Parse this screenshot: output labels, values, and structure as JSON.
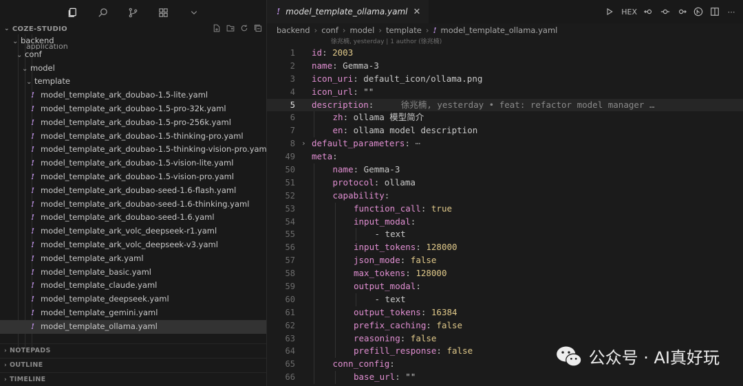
{
  "activity_bar": {
    "icons": [
      "files-icon",
      "search-icon",
      "source-control-icon",
      "extensions-icon",
      "chevron-down-icon"
    ]
  },
  "explorer": {
    "title": "COZE-STUDIO",
    "folders": {
      "backend": "backend",
      "peek": "application",
      "conf": "conf",
      "model": "model",
      "template": "template"
    },
    "files": [
      "model_template_ark_doubao-1.5-lite.yaml",
      "model_template_ark_doubao-1.5-pro-32k.yaml",
      "model_template_ark_doubao-1.5-pro-256k.yaml",
      "model_template_ark_doubao-1.5-thinking-pro.yaml",
      "model_template_ark_doubao-1.5-thinking-vision-pro.yaml",
      "model_template_ark_doubao-1.5-vision-lite.yaml",
      "model_template_ark_doubao-1.5-vision-pro.yaml",
      "model_template_ark_doubao-seed-1.6-flash.yaml",
      "model_template_ark_doubao-seed-1.6-thinking.yaml",
      "model_template_ark_doubao-seed-1.6.yaml",
      "model_template_ark_volc_deepseek-r1.yaml",
      "model_template_ark_volc_deepseek-v3.yaml",
      "model_template_ark.yaml",
      "model_template_basic.yaml",
      "model_template_claude.yaml",
      "model_template_deepseek.yaml",
      "model_template_gemini.yaml",
      "model_template_ollama.yaml"
    ],
    "selected_index": 17,
    "panels": [
      "NOTEPADS",
      "OUTLINE",
      "TIMELINE"
    ]
  },
  "editor": {
    "tab_title": "model_template_ollama.yaml",
    "toolbar_hex": "HEX",
    "breadcrumb": [
      "backend",
      "conf",
      "model",
      "template",
      "model_template_ollama.yaml"
    ],
    "blame_hint": "徐兆楠, yesterday | 1 author (徐兆楠)",
    "inline_blame": "徐兆楠, yesterday • feat: refactor model manager …",
    "current_line": "5",
    "lines": [
      {
        "n": "1",
        "indent": 0,
        "key": "id",
        "value": "2003",
        "vt": "n"
      },
      {
        "n": "2",
        "indent": 0,
        "key": "name",
        "value": "Gemma-3",
        "vt": "s"
      },
      {
        "n": "3",
        "indent": 0,
        "key": "icon_uri",
        "value": "default_icon/ollama.png",
        "vt": "s"
      },
      {
        "n": "4",
        "indent": 0,
        "key": "icon_url",
        "value": "\"\"",
        "vt": "s"
      },
      {
        "n": "5",
        "indent": 0,
        "key": "description",
        "value": "",
        "vt": "s",
        "blame": true
      },
      {
        "n": "6",
        "indent": 1,
        "key": "zh",
        "value": "ollama 模型简介",
        "vt": "s"
      },
      {
        "n": "7",
        "indent": 1,
        "key": "en",
        "value": "ollama model description",
        "vt": "s"
      },
      {
        "n": "8",
        "indent": 0,
        "key": "default_parameters",
        "value": "",
        "vt": "s",
        "folded": true
      },
      {
        "n": "49",
        "indent": 0,
        "key": "meta",
        "value": "",
        "vt": "s"
      },
      {
        "n": "50",
        "indent": 1,
        "key": "name",
        "value": "Gemma-3",
        "vt": "s"
      },
      {
        "n": "51",
        "indent": 1,
        "key": "protocol",
        "value": "ollama",
        "vt": "s"
      },
      {
        "n": "52",
        "indent": 1,
        "key": "capability",
        "value": "",
        "vt": "s"
      },
      {
        "n": "53",
        "indent": 2,
        "key": "function_call",
        "value": "true",
        "vt": "b"
      },
      {
        "n": "54",
        "indent": 2,
        "key": "input_modal",
        "value": "",
        "vt": "s"
      },
      {
        "n": "55",
        "indent": 3,
        "key": "",
        "value": "- text",
        "vt": "s"
      },
      {
        "n": "56",
        "indent": 2,
        "key": "input_tokens",
        "value": "128000",
        "vt": "n"
      },
      {
        "n": "57",
        "indent": 2,
        "key": "json_mode",
        "value": "false",
        "vt": "b"
      },
      {
        "n": "58",
        "indent": 2,
        "key": "max_tokens",
        "value": "128000",
        "vt": "n"
      },
      {
        "n": "59",
        "indent": 2,
        "key": "output_modal",
        "value": "",
        "vt": "s"
      },
      {
        "n": "60",
        "indent": 3,
        "key": "",
        "value": "- text",
        "vt": "s"
      },
      {
        "n": "61",
        "indent": 2,
        "key": "output_tokens",
        "value": "16384",
        "vt": "n"
      },
      {
        "n": "62",
        "indent": 2,
        "key": "prefix_caching",
        "value": "false",
        "vt": "b"
      },
      {
        "n": "63",
        "indent": 2,
        "key": "reasoning",
        "value": "false",
        "vt": "b"
      },
      {
        "n": "64",
        "indent": 2,
        "key": "prefill_response",
        "value": "false",
        "vt": "b"
      },
      {
        "n": "65",
        "indent": 1,
        "key": "conn_config",
        "value": "",
        "vt": "s"
      },
      {
        "n": "66",
        "indent": 2,
        "key": "base_url",
        "value": "\"\"",
        "vt": "s"
      }
    ]
  },
  "watermark": {
    "text": "公众号 · AI真好玩"
  },
  "colors": {
    "key": "#e18fd2",
    "number": "#e0c98a",
    "yaml_icon": "#b98de0"
  }
}
